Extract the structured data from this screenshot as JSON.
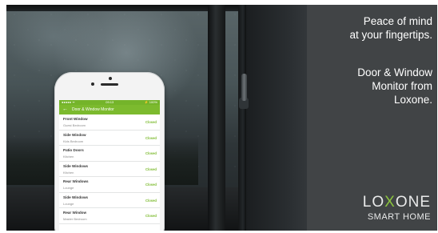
{
  "panel": {
    "headline_lines": [
      "Peace of mind",
      "at your fingertips."
    ],
    "sub_lines": [
      "Door & Window",
      "Monitor from",
      "Loxone."
    ]
  },
  "logo": {
    "brand_before": "LO",
    "brand_mark": "X",
    "brand_after": "ONE",
    "tagline": "SMART HOME"
  },
  "app": {
    "statusbar": {
      "left": "●●●●● ᯤ",
      "center": "09:13",
      "right": "⚡ 100%"
    },
    "title": "Door & Window Monitor",
    "items": [
      {
        "name": "Front Window",
        "room": "Guest Bedroom",
        "state": "Closed"
      },
      {
        "name": "Side Window",
        "room": "Kids Bedroom",
        "state": "Closed"
      },
      {
        "name": "Patio Doors",
        "room": "Kitchen",
        "state": "Closed"
      },
      {
        "name": "Side Windows",
        "room": "Kitchen",
        "state": "Closed"
      },
      {
        "name": "Rear Windows",
        "room": "Lounge",
        "state": "Closed"
      },
      {
        "name": "Side Windows",
        "room": "Lounge",
        "state": "Closed"
      },
      {
        "name": "Rear Window",
        "room": "Master Bedroom",
        "state": "Closed"
      }
    ]
  },
  "colors": {
    "accent": "#7cba2e",
    "panel": "#414446"
  }
}
